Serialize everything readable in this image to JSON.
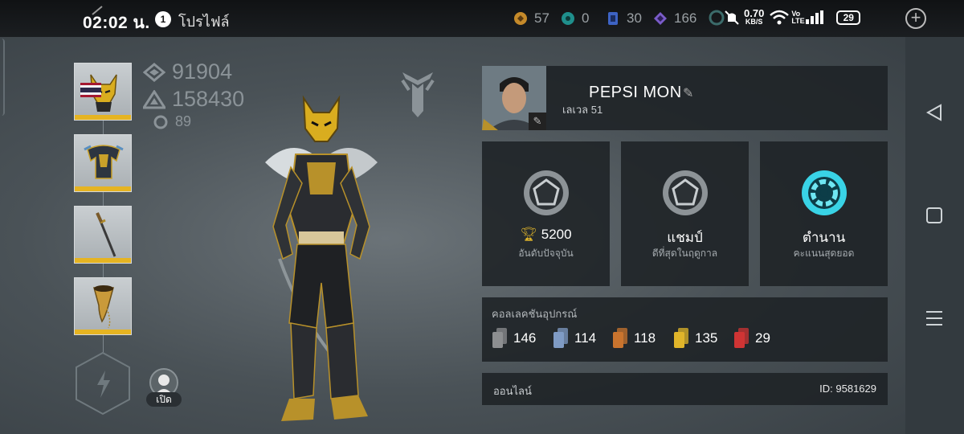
{
  "status_bar": {
    "time": "02:02 น.",
    "notification_count": "1",
    "screen_title": "โปรไฟล์",
    "net_speed": "0.70",
    "net_unit": "KB/S",
    "volte": "Vo LTE",
    "battery": "29"
  },
  "currencies": [
    {
      "name": "coin-icon",
      "color": "#c58a2a",
      "value": "57"
    },
    {
      "name": "gem-icon",
      "color": "#2ab3b0",
      "value": "0"
    },
    {
      "name": "card-icon",
      "color": "#3d63c4",
      "value": "30"
    },
    {
      "name": "crystal-icon",
      "color": "#7a5cc9",
      "value": "166"
    }
  ],
  "stats": {
    "power": "91904",
    "rating": "158430",
    "upgrades": "89"
  },
  "open_button_label": "เปิด",
  "profile": {
    "name": "PEPSI MON",
    "level": "เลเวล 51"
  },
  "ranks": [
    {
      "value": "5200",
      "label": "อันดับปัจจุบัน",
      "icon": "trophy-icon"
    },
    {
      "value": "แชมป์",
      "label": "ดีที่สุดในฤดูกาล",
      "icon": "rank-emblem-icon"
    },
    {
      "value": "ตำนาน",
      "label": "คะแนนสุดยอด",
      "icon": "legend-emblem-icon"
    }
  ],
  "collection": {
    "title": "คอลเลคชันอุปกรณ์",
    "items": [
      {
        "color": "#8d8f91",
        "value": "146"
      },
      {
        "color": "#7f9bc4",
        "value": "114"
      },
      {
        "color": "#c9742e",
        "value": "118"
      },
      {
        "color": "#e0b52a",
        "value": "135"
      },
      {
        "color": "#cf3434",
        "value": "29"
      }
    ]
  },
  "status": {
    "online": "ออนไลน์",
    "id": "ID: 9581629"
  }
}
